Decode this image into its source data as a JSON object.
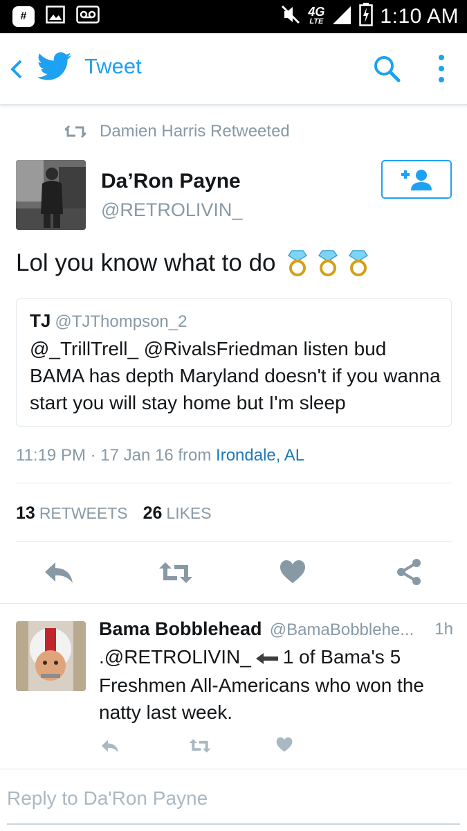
{
  "status_bar": {
    "time": "1:10 AM",
    "network": "4G",
    "network_sub": "LTE",
    "icons": [
      "hash-icon",
      "image-icon",
      "voicemail-icon",
      "mute-icon",
      "signal-icon",
      "battery-icon"
    ]
  },
  "app_bar": {
    "title": "Tweet",
    "accent_color": "#1da1f2"
  },
  "retweet_line": {
    "text": "Damien Harris Retweeted"
  },
  "tweet": {
    "author_name": "Da’Ron Payne",
    "author_handle": "@RETROLIVIN_",
    "text": "Lol you know what to do",
    "emoji_count": 3,
    "quote": {
      "name": "TJ",
      "handle": "@TJThompson_2",
      "text": "@_TrillTrell_ @RivalsFriedman listen bud BAMA has depth Maryland doesn't if you wanna start you will stay home but I'm sleep"
    },
    "timestamp": "11:19 PM · 17 Jan 16",
    "from_label": "from",
    "location": "Irondale, AL",
    "retweets_count": "13",
    "retweets_label": "RETWEETS",
    "likes_count": "26",
    "likes_label": "LIKES"
  },
  "reply": {
    "name": "Bama Bobblehead",
    "handle": "@BamaBobblehe...",
    "time": "1h",
    "mention": ".@RETROLIVIN_",
    "text_after_arrow": "1 of Bama's 5 Freshmen All-Americans who won the natty last week."
  },
  "composer": {
    "placeholder": "Reply to Da'Ron Payne"
  }
}
